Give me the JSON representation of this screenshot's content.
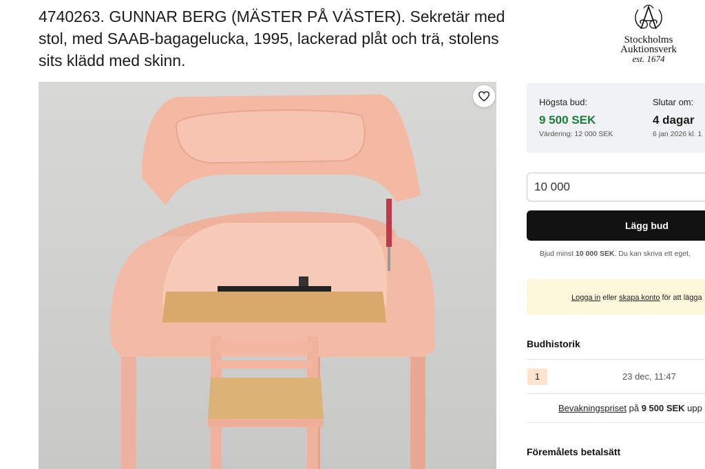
{
  "lot": {
    "title": "4740263. GUNNAR BERG (MÄSTER PÅ VÄSTER). Sekretär med stol, med SAAB-bagagelucka, 1995, lackerad plåt och trä, stolens sits klädd med skinn."
  },
  "logo": {
    "line1": "Stockholms",
    "line2": "Auktionsverk",
    "line3": "est. 1674"
  },
  "image": {
    "favorite_icon": "heart-icon"
  },
  "bid_info": {
    "highest_label": "Högsta bud:",
    "highest_value": "9 500 SEK",
    "estimate": "Värdering: 12 000 SEK",
    "ends_label": "Slutar om:",
    "ends_value": "4 dagar",
    "ends_date": "6 jan 2026 kl. 1",
    "accent_color": "#1b7d3a"
  },
  "bid_form": {
    "input_value": "10 000",
    "button_label": "Lägg bud",
    "hint_prefix": "Bjud minst ",
    "hint_amount": "10 000 SEK",
    "hint_suffix": ". Du kan skriva ett eget,"
  },
  "login_notice": {
    "login_link": "Logga in",
    "middle": " eller ",
    "create_link": "skapa konto",
    "suffix": " för att lägga"
  },
  "bid_history": {
    "title": "Budhistorik",
    "entries": [
      {
        "number": "1",
        "time": "23 dec, 11:47"
      }
    ],
    "reserve_link": "Bevakningspriset",
    "reserve_mid": " på ",
    "reserve_amount": "9 500 SEK",
    "reserve_suffix": " upp"
  },
  "payment": {
    "title": "Föremålets betalsätt"
  }
}
